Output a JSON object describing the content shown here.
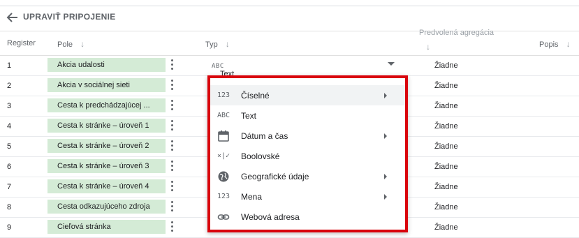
{
  "header": {
    "title": "UPRAVIŤ PRIPOJENIE"
  },
  "columns": {
    "register": "Register",
    "field": "Pole",
    "type": "Typ",
    "aggregation": "Predvolená agregácia",
    "description": "Popis"
  },
  "rows": [
    {
      "num": "1",
      "field": "Akcia udalosti",
      "agg": "Žiadne"
    },
    {
      "num": "2",
      "field": "Akcia v sociálnej sieti",
      "agg": "Žiadne"
    },
    {
      "num": "3",
      "field": "Cesta k predchádzajúcej ...",
      "agg": "Žiadne"
    },
    {
      "num": "4",
      "field": "Cesta k stránke – úroveň 1",
      "agg": "Žiadne"
    },
    {
      "num": "5",
      "field": "Cesta k stránke – úroveň 2",
      "agg": "Žiadne"
    },
    {
      "num": "6",
      "field": "Cesta k stránke – úroveň 3",
      "agg": "Žiadne"
    },
    {
      "num": "7",
      "field": "Cesta k stránke – úroveň 4",
      "agg": "Žiadne"
    },
    {
      "num": "8",
      "field": "Cesta odkazujúceho zdroja",
      "agg": "Žiadne"
    },
    {
      "num": "9",
      "field": "Cieľová stránka",
      "agg": "Žiadne"
    }
  ],
  "row1_type": {
    "icon": "ABC",
    "label": "Text"
  },
  "menu": {
    "highlight_color": "#f1f3f4",
    "border_color": "#d9040c",
    "items": [
      {
        "icon": "numeric-icon",
        "icon_text": "123",
        "label": "Číselné"
      },
      {
        "icon": "text-icon",
        "icon_text": "ABC",
        "label": "Text"
      },
      {
        "icon": "calendar-icon",
        "label": "Dátum a čas"
      },
      {
        "icon": "boolean-icon",
        "label": "Boolovské"
      },
      {
        "icon": "globe-icon",
        "label": "Geografické údaje"
      },
      {
        "icon": "currency-icon",
        "icon_text": "123",
        "label": "Mena"
      },
      {
        "icon": "link-icon",
        "label": "Webová adresa"
      }
    ]
  }
}
